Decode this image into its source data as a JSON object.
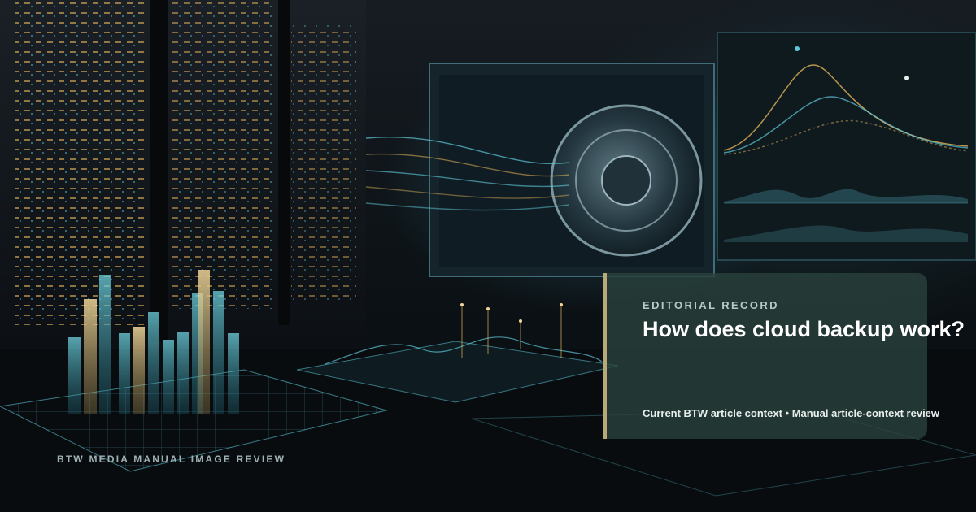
{
  "image": {
    "subject": "data-center",
    "colors": {
      "accent": "#b9a977",
      "panel": "#2a423e",
      "glow": "#5ec8d8",
      "light": "#e2b45a"
    }
  },
  "caption": "BTW MEDIA MANUAL IMAGE REVIEW",
  "card": {
    "label": "EDITORIAL RECORD",
    "title": "How does cloud backup work?",
    "meta": "Current BTW article context • Manual article-context review"
  }
}
